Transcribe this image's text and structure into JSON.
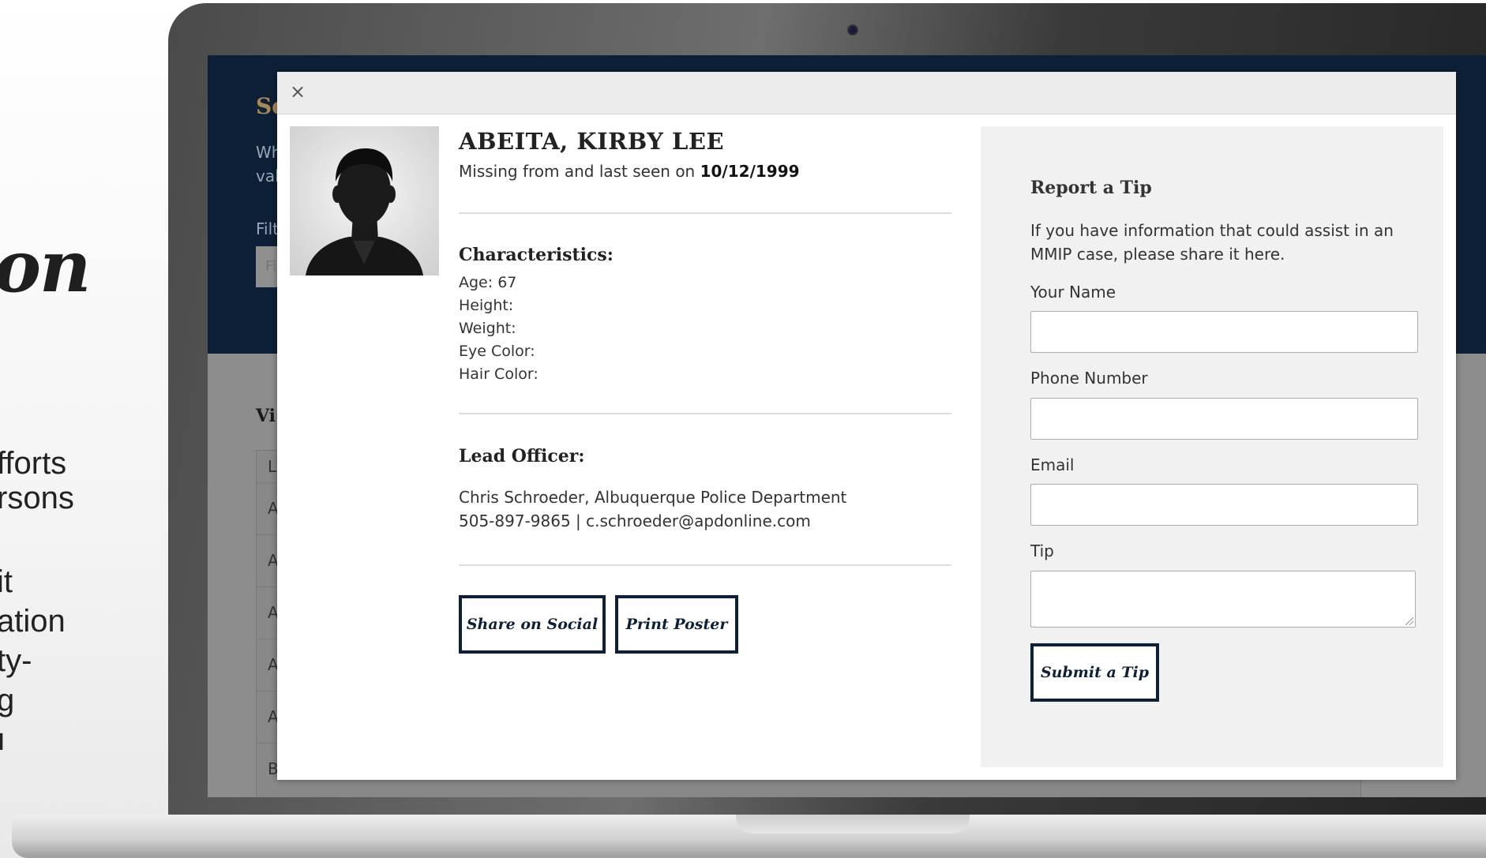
{
  "slide": {
    "title_fragment": "on",
    "lines": [
      "fforts",
      "rsons",
      "it",
      "ation",
      "ty-",
      "g",
      "ı"
    ]
  },
  "background_page": {
    "heading": "Se",
    "subtitle_lines": [
      "Wh",
      "val"
    ],
    "filter_label": "Filt",
    "filter_placeholder": "Fi",
    "list_title": "Vi",
    "table_header": "La",
    "row_initials": [
      "A",
      "A",
      "A",
      "A",
      "A",
      "B"
    ]
  },
  "modal": {
    "close_glyph": "×",
    "person": {
      "name": "ABEITA, KIRBY LEE",
      "missing_prefix": "Missing from and last seen on ",
      "missing_date": "10/12/1999"
    },
    "characteristics": {
      "heading": "Characteristics:",
      "items": [
        "Age: 67",
        "Height:",
        "Weight:",
        "Eye Color:",
        "Hair Color:"
      ]
    },
    "lead_officer": {
      "heading": "Lead Officer:",
      "name_line": "Chris Schroeder, Albuquerque Police Department",
      "contact_line": "505-897-9865 | c.schroeder@apdonline.com"
    },
    "buttons": {
      "share": "Share on Social",
      "print": "Print Poster"
    },
    "tip_form": {
      "heading": "Report a Tip",
      "description": "If you have information that could assist in an MMIP case, please share it here.",
      "name_label": "Your Name",
      "name_value": "",
      "phone_label": "Phone Number",
      "phone_value": "",
      "email_label": "Email",
      "email_value": "",
      "tip_label": "Tip",
      "tip_value": "",
      "submit": "Submit a Tip"
    }
  },
  "colors": {
    "navy": "#0e2037",
    "gold": "#a98757",
    "panel": "#f1f1f1"
  }
}
